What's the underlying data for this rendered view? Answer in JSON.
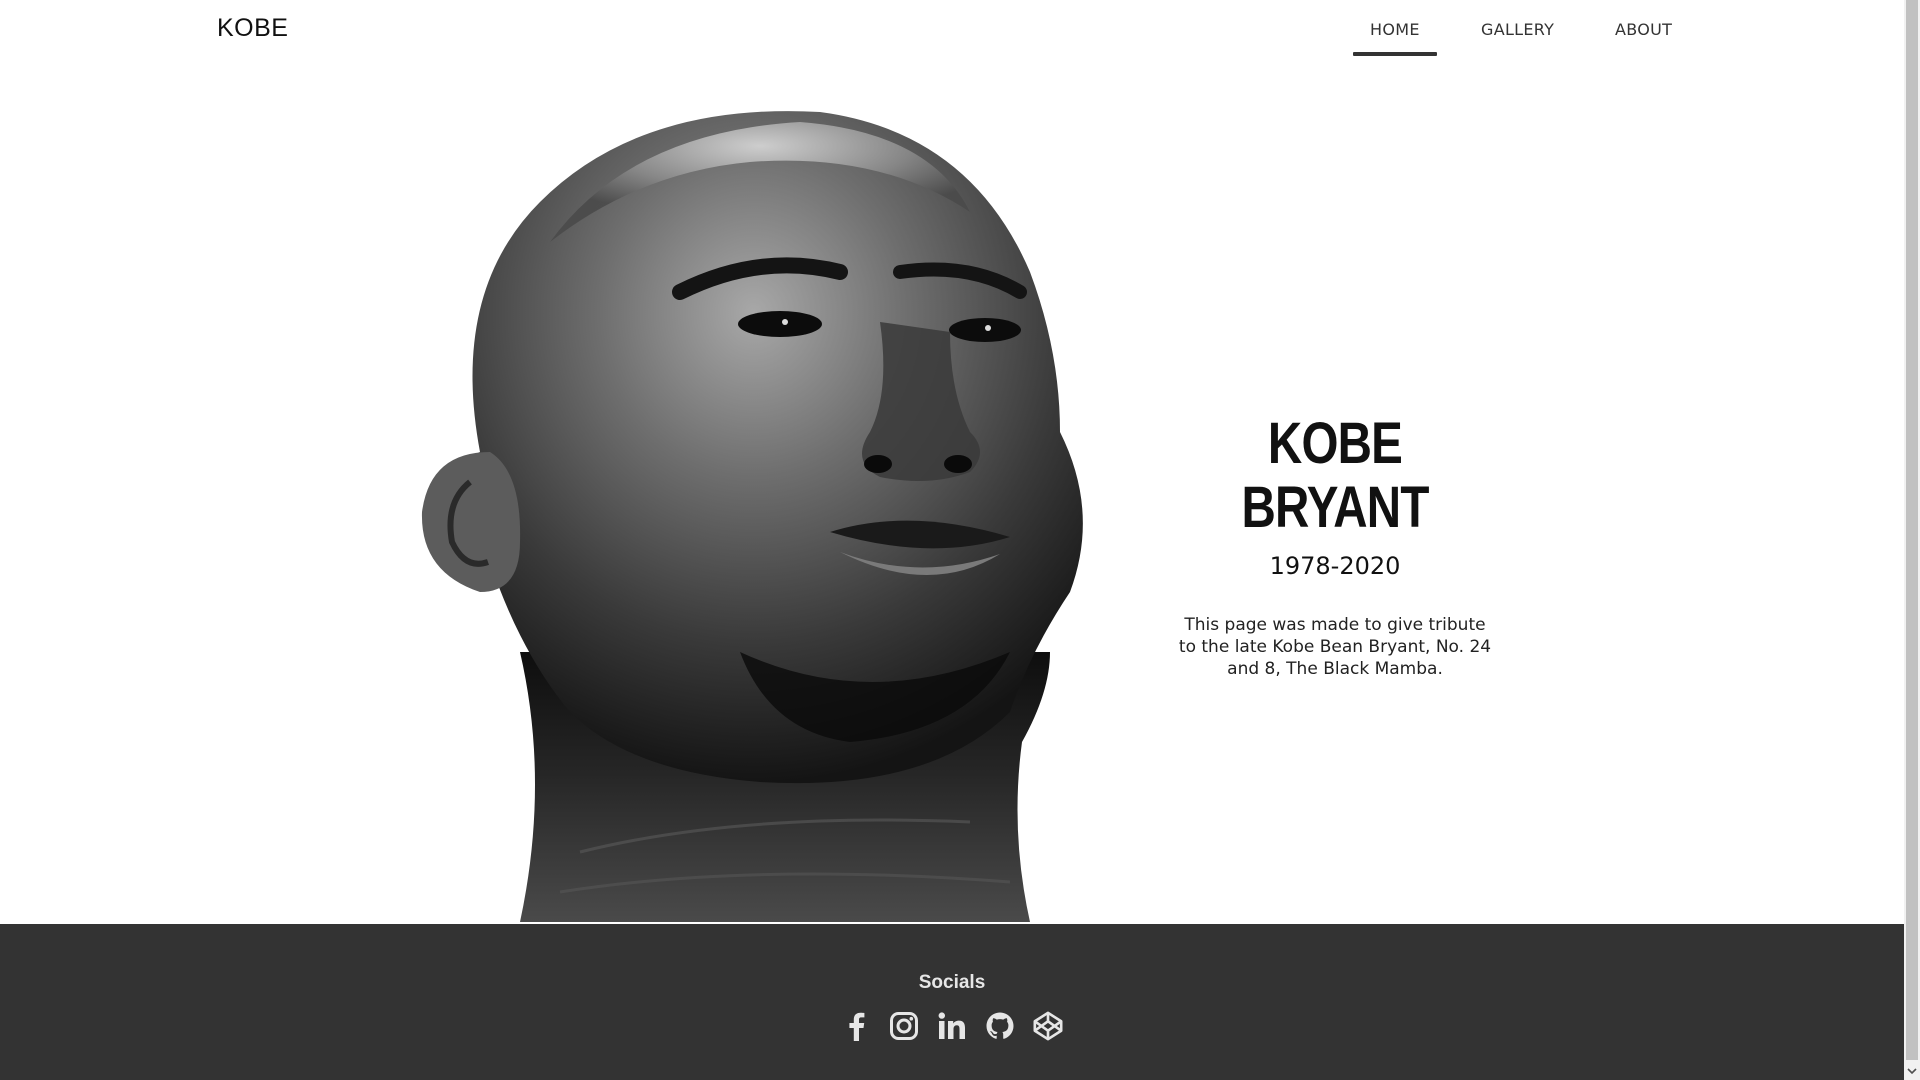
{
  "navbar": {
    "brand": "KOBE",
    "items": [
      {
        "label": "HOME",
        "active": true
      },
      {
        "label": "GALLERY",
        "active": false
      },
      {
        "label": "ABOUT",
        "active": false
      }
    ]
  },
  "hero": {
    "title": "KOBE BRYANT",
    "years": "1978-2020",
    "description": "This page was made to give tribute to the late Kobe Bean Bryant, No. 24 and 8, The Black Mamba.",
    "image": "black-and-white portrait photo"
  },
  "footer": {
    "title": "Socials",
    "icons": [
      "facebook-icon",
      "instagram-icon",
      "linkedin-icon",
      "github-icon",
      "codepen-icon"
    ]
  },
  "colors": {
    "background": "#ffffff",
    "text": "#111111",
    "footer_bg": "#333333",
    "footer_text": "#e6e6e6",
    "nav_indicator": "#333333"
  }
}
